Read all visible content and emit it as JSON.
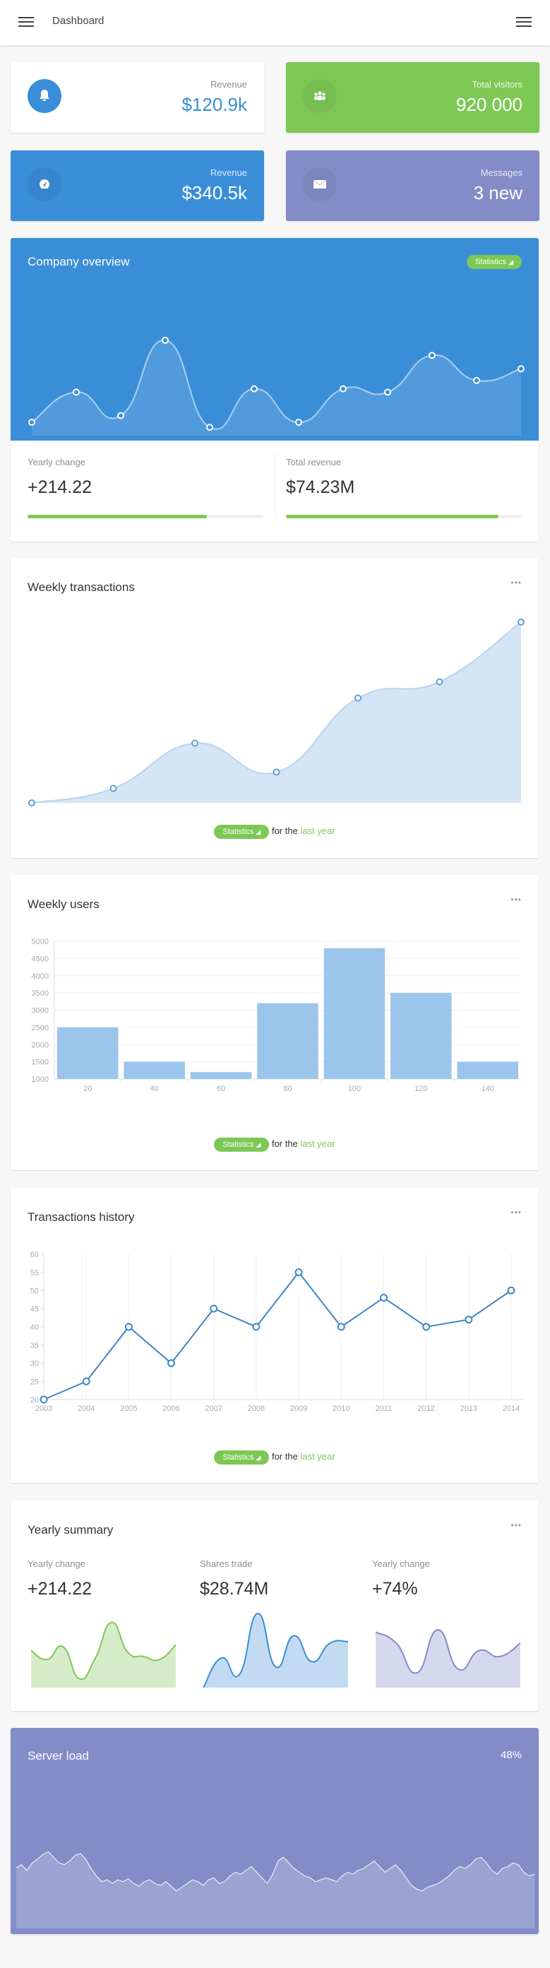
{
  "header": {
    "title": "Dashboard",
    "menu_left_icon": "hamburger-icon",
    "menu_right_icon": "hamburger-icon"
  },
  "stats": [
    {
      "label": "Revenue",
      "value": "$120.9k",
      "icon": "bell-icon",
      "bg": "#ffffff",
      "accent": "#3a8ed8"
    },
    {
      "label": "Total visitors",
      "value": "920 000",
      "icon": "users-icon",
      "bg": "#7dc855",
      "accent": "#ffffff"
    },
    {
      "label": "Revenue",
      "value": "$340.5k",
      "icon": "dashboard-gauge-icon",
      "bg": "#3a8ed8",
      "accent": "#ffffff"
    },
    {
      "label": "Messages",
      "value": "3 new",
      "icon": "envelope-icon",
      "bg": "#838cc7",
      "accent": "#ffffff"
    }
  ],
  "company_overview": {
    "title": "Company overview",
    "badge": "Statistics",
    "yearly_change": {
      "label": "Yearly change",
      "value": "+214.22",
      "progress": 0.76
    },
    "total_revenue": {
      "label": "Total revenue",
      "value": "$74.23M",
      "progress": 0.9
    }
  },
  "weekly_transactions": {
    "title": "Weekly transactions",
    "badge": "Statistics",
    "footer_text": "for the",
    "footer_accent": "last year"
  },
  "weekly_users": {
    "title": "Weekly users",
    "badge": "Statistics",
    "footer_text": "for the",
    "footer_accent": "last year"
  },
  "transactions_history": {
    "title": "Transactions history",
    "badge": "Statistics",
    "footer_text": "for the",
    "footer_accent": "last year"
  },
  "yearly_summary": {
    "title": "Yearly summary",
    "items": [
      {
        "label": "Yearly change",
        "value": "+214.22"
      },
      {
        "label": "Shares trade",
        "value": "$28.74M"
      },
      {
        "label": "Yearly change",
        "value": "+74%"
      }
    ]
  },
  "server_load": {
    "title": "Server load",
    "value": "48%"
  },
  "chart_data": [
    {
      "id": "company_overview",
      "type": "area",
      "title": "Company overview",
      "x": [
        1,
        2,
        3,
        4,
        5,
        6,
        7,
        8,
        9,
        10,
        11,
        12
      ],
      "values": [
        8,
        26,
        12,
        57,
        5,
        28,
        8,
        28,
        26,
        48,
        33,
        40
      ],
      "ylim": [
        0,
        100
      ],
      "grid": false
    },
    {
      "id": "weekly_transactions",
      "type": "area",
      "title": "Weekly transactions",
      "x": [
        1,
        2,
        3,
        4,
        5,
        6,
        7
      ],
      "values": [
        0,
        8,
        33,
        17,
        58,
        67,
        100
      ],
      "ylim": [
        0,
        100
      ],
      "grid": false
    },
    {
      "id": "weekly_users",
      "type": "bar",
      "title": "Weekly users",
      "categories": [
        "20",
        "40",
        "60",
        "80",
        "100",
        "120",
        "140"
      ],
      "values": [
        2500,
        1500,
        1200,
        3200,
        4800,
        3500,
        1500
      ],
      "yticks": [
        1000,
        1500,
        2000,
        2500,
        3000,
        3500,
        4000,
        4500,
        5000
      ],
      "ylim": [
        1000,
        5000
      ],
      "grid": true
    },
    {
      "id": "transactions_history",
      "type": "line",
      "title": "Transactions history",
      "categories": [
        "2003",
        "2004",
        "2005",
        "2006",
        "2007",
        "2008",
        "2009",
        "2010",
        "2011",
        "2012",
        "2013",
        "2014"
      ],
      "values": [
        20,
        25,
        40,
        30,
        45,
        40,
        55,
        40,
        48,
        40,
        42,
        50
      ],
      "yticks": [
        20,
        25,
        30,
        35,
        40,
        45,
        50,
        55,
        60
      ],
      "ylim": [
        20,
        60
      ],
      "grid": true
    },
    {
      "id": "yearly_summary_1",
      "type": "area",
      "title": "Yearly change",
      "values": [
        50,
        38,
        55,
        12,
        40,
        88,
        48,
        42,
        38,
        58
      ],
      "ylim": [
        0,
        100
      ],
      "color": "#7dc855"
    },
    {
      "id": "yearly_summary_2",
      "type": "area",
      "title": "Shares trade",
      "values": [
        0,
        40,
        18,
        100,
        28,
        70,
        35,
        60,
        62
      ],
      "ylim": [
        0,
        100
      ],
      "color": "#3a8ed8"
    },
    {
      "id": "yearly_summary_3",
      "type": "area",
      "title": "Yearly change",
      "values": [
        75,
        60,
        20,
        78,
        25,
        50,
        42,
        60
      ],
      "ylim": [
        0,
        100
      ],
      "color": "#838cc7"
    },
    {
      "id": "server_load",
      "type": "area",
      "title": "Server load",
      "values": [
        65,
        68,
        62,
        70,
        74,
        79,
        82,
        76,
        70,
        68,
        72,
        78,
        80,
        74,
        64,
        56,
        50,
        52,
        48,
        52,
        50,
        53,
        48,
        45,
        50,
        52,
        48,
        46,
        50,
        45,
        40,
        44,
        48,
        52,
        50,
        46,
        52,
        54,
        48,
        50,
        56,
        60,
        58,
        62,
        66,
        60,
        54,
        48,
        58,
        72,
        76,
        70,
        64,
        60,
        56,
        54,
        50,
        52,
        54,
        52,
        50,
        56,
        60,
        58,
        62,
        64,
        68,
        72,
        66,
        60,
        64,
        68,
        62,
        54,
        46,
        42,
        40,
        44,
        46,
        48,
        52,
        56,
        62,
        66,
        64,
        68,
        74,
        76,
        70,
        62,
        58,
        64,
        66,
        70,
        68,
        60,
        56,
        58
      ],
      "ylim": [
        0,
        100
      ],
      "color": "#ffffff"
    }
  ]
}
